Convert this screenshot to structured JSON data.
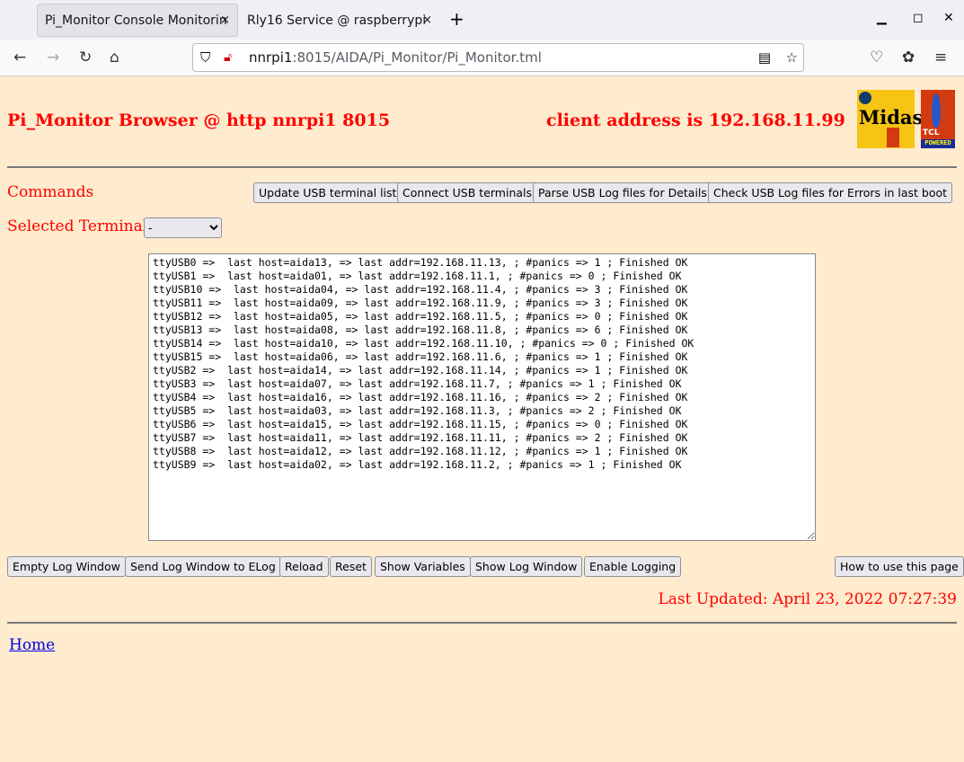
{
  "browser": {
    "tabs": [
      {
        "label": "Pi_Monitor Console Monitorin"
      },
      {
        "label": "Rly16 Service @ raspberrypi"
      }
    ],
    "url_host": "nnrpi1",
    "url_rest": ":8015/AIDA/Pi_Monitor/Pi_Monitor.tml"
  },
  "header": {
    "title": "Pi_Monitor Browser @ http nnrpi1 8015",
    "client": "client address is 192.168.11.99",
    "logo_midas": "Midas",
    "logo_tcl": "TCL POWERED"
  },
  "commands": {
    "label": "Commands",
    "buttons": [
      "Update USB terminal list",
      "Connect USB terminals",
      "Parse USB Log files for Details",
      "Check USB Log files for Errors in last boot"
    ]
  },
  "terminal": {
    "label": "Selected Terminal",
    "selected": "-"
  },
  "log": "ttyUSB0 =>  last host=aida13, => last addr=192.168.11.13, ; #panics => 1 ; Finished OK\nttyUSB1 =>  last host=aida01, => last addr=192.168.11.1, ; #panics => 0 ; Finished OK\nttyUSB10 =>  last host=aida04, => last addr=192.168.11.4, ; #panics => 3 ; Finished OK\nttyUSB11 =>  last host=aida09, => last addr=192.168.11.9, ; #panics => 3 ; Finished OK\nttyUSB12 =>  last host=aida05, => last addr=192.168.11.5, ; #panics => 0 ; Finished OK\nttyUSB13 =>  last host=aida08, => last addr=192.168.11.8, ; #panics => 6 ; Finished OK\nttyUSB14 =>  last host=aida10, => last addr=192.168.11.10, ; #panics => 0 ; Finished OK\nttyUSB15 =>  last host=aida06, => last addr=192.168.11.6, ; #panics => 1 ; Finished OK\nttyUSB2 =>  last host=aida14, => last addr=192.168.11.14, ; #panics => 1 ; Finished OK\nttyUSB3 =>  last host=aida07, => last addr=192.168.11.7, ; #panics => 1 ; Finished OK\nttyUSB4 =>  last host=aida16, => last addr=192.168.11.16, ; #panics => 2 ; Finished OK\nttyUSB5 =>  last host=aida03, => last addr=192.168.11.3, ; #panics => 2 ; Finished OK\nttyUSB6 =>  last host=aida15, => last addr=192.168.11.15, ; #panics => 0 ; Finished OK\nttyUSB7 =>  last host=aida11, => last addr=192.168.11.11, ; #panics => 2 ; Finished OK\nttyUSB8 =>  last host=aida12, => last addr=192.168.11.12, ; #panics => 1 ; Finished OK\nttyUSB9 =>  last host=aida02, => last addr=192.168.11.2, ; #panics => 1 ; Finished OK",
  "bottom": {
    "buttons": [
      "Empty Log Window",
      "Send Log Window to ELog",
      "Reload",
      "Reset",
      "Show Variables",
      "Show Log Window",
      "Enable Logging"
    ],
    "help": "How to use this page"
  },
  "last_updated": "Last Updated: April 23, 2022 07:27:39",
  "home_link": "Home"
}
